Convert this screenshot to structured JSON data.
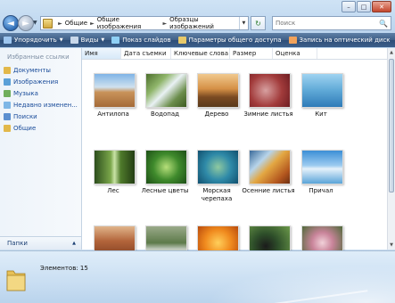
{
  "window": {
    "caption": {
      "minimize": "–",
      "maximize": "□",
      "close": "✕"
    }
  },
  "nav": {
    "back": "◄",
    "forward": "►",
    "dropdown": "▼"
  },
  "address": {
    "parts": [
      "Общие",
      "Общие изображения",
      "Образцы изображений"
    ],
    "separator": "►",
    "dropdown": "▼"
  },
  "search": {
    "placeholder": "Поиск",
    "icon": "🔍"
  },
  "refresh_icon": "↻",
  "toolbar": {
    "items": [
      {
        "label": "Упорядочить",
        "icon": "organize-icon",
        "color": "#9ec6ef",
        "has_arrow": true
      },
      {
        "label": "Виды",
        "icon": "views-icon",
        "color": "#c9d8ea",
        "has_arrow": true
      },
      {
        "label": "Показ слайдов",
        "icon": "slideshow-icon",
        "color": "#8fd0f5",
        "has_arrow": false
      },
      {
        "label": "Параметры общего доступа",
        "icon": "share-icon",
        "color": "#e7c96a",
        "has_arrow": false
      },
      {
        "label": "Запись на оптический диск",
        "icon": "burn-icon",
        "color": "#f1a25b",
        "has_arrow": false
      }
    ],
    "arrow": "▼",
    "help": "?"
  },
  "left_panel": {
    "header": "Избранные ссылки",
    "links": [
      {
        "label": "Документы",
        "color": "#e2b84a"
      },
      {
        "label": "Изображения",
        "color": "#5aa0d8"
      },
      {
        "label": "Музыка",
        "color": "#6fae5c"
      },
      {
        "label": "Недавно изменен...",
        "color": "#7db6e6"
      },
      {
        "label": "Поиски",
        "color": "#5b8fd0"
      },
      {
        "label": "Общие",
        "color": "#e2b84a"
      }
    ],
    "folders_label": "Папки",
    "folders_arrow": "▲"
  },
  "columns": [
    "Имя",
    "Дата съемки",
    "Ключевые слова",
    "Размер",
    "Оценка"
  ],
  "images": [
    {
      "caption": "Антилопа",
      "bg": "linear-gradient(#7fb4e6 0%,#cfe1ee 40%,#c9935a 55%,#a46a38 100%)"
    },
    {
      "caption": "Водопад",
      "bg": "linear-gradient(135deg,#4c6e2c 0%,#8fb56a 30%,#e9f1f4 50%,#6b8d4b 75%,#3e5b22 100%)"
    },
    {
      "caption": "Дерево",
      "bg": "linear-gradient(#f1c98e 0%,#d59046 45%,#7b4a22 70%,#5a3b1c 100%)"
    },
    {
      "caption": "Зимние листья",
      "bg": "radial-gradient(circle at 40% 50%,#d7a0a0,#a23b3b 55%,#6d1d22 100%)"
    },
    {
      "caption": "Кит",
      "bg": "linear-gradient(#9fd3f1 0%,#5fa9d7 50%,#2f7bb8 100%)"
    },
    {
      "caption": "Лес",
      "bg": "linear-gradient(90deg,#2d4e1d 0%,#7aa64a 40%,#c9e3a6 50%,#4f7b2b 65%,#233d14 100%)"
    },
    {
      "caption": "Лесные цветы",
      "bg": "radial-gradient(circle at 50% 50%,#b6df7a,#3f8a2c 50%,#1d4f17 100%)"
    },
    {
      "caption": "Морская черепаха",
      "bg": "radial-gradient(circle at 50% 50%,#8fc9a0,#2f8aa8 50%,#11506f 100%)"
    },
    {
      "caption": "Осенние листья",
      "bg": "linear-gradient(135deg,#3a6a9a 0%,#b7d4ea 30%,#e3a742 50%,#b3561e 80%,#6d2f12 100%)"
    },
    {
      "caption": "Причал",
      "bg": "linear-gradient(#3c8fd6 0%,#9ccbf0 45%,#e6f2fb 55%,#5aa4d8 100%)"
    },
    {
      "caption": "",
      "bg": "linear-gradient(#e0b48a 0%,#b2643a 45%,#7a3a20 100%)"
    },
    {
      "caption": "",
      "bg": "linear-gradient(#9aaa8a 0%,#5d7a4a 50%,#c7cfc4 70%,#4c6a3a 100%)"
    },
    {
      "caption": "",
      "bg": "radial-gradient(circle at 50% 50%,#ffcf5a,#f08a1e 50%,#b94a0c 100%)"
    },
    {
      "caption": "",
      "bg": "radial-gradient(circle at 40% 60%,#1b1b1b,#2e4f2a 40%,#6c9a4a 100%)"
    },
    {
      "caption": "",
      "bg": "radial-gradient(circle at 50% 50%,#f1d1d9,#c9849a 40%,#4f6a3a 100%)"
    }
  ],
  "status": {
    "count": "Элементов: 15"
  }
}
